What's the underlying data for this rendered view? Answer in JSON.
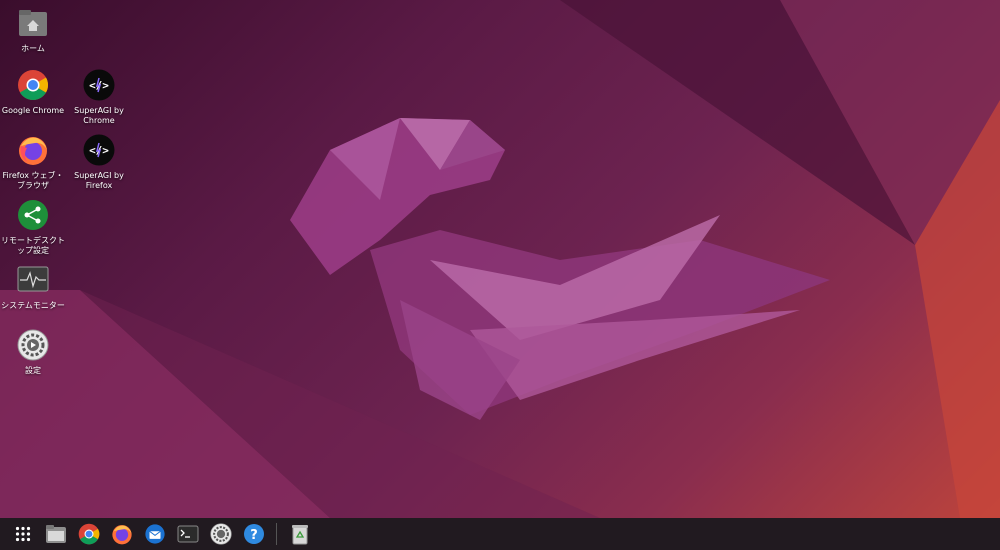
{
  "desktop": {
    "icons": [
      {
        "label": "ホーム",
        "icon": "home-folder-icon"
      },
      {
        "label": "Google Chrome",
        "icon": "chrome-icon"
      },
      {
        "label": "SuperAGI by Chrome",
        "icon": "superagi-icon"
      },
      {
        "label": "Firefox ウェブ・ブラウザ",
        "icon": "firefox-icon"
      },
      {
        "label": "SuperAGI by Firefox",
        "icon": "superagi-icon"
      },
      {
        "label": "リモートデスクトップ設定",
        "icon": "remote-desktop-icon"
      },
      {
        "label": "システムモニター",
        "icon": "system-monitor-icon"
      },
      {
        "label": "設定",
        "icon": "settings-icon"
      }
    ]
  },
  "dock": {
    "items": [
      "apps-grid-icon",
      "files-icon",
      "chrome-icon",
      "firefox-icon",
      "thunderbird-icon",
      "terminal-icon",
      "settings-icon",
      "help-icon",
      "trash-icon"
    ]
  },
  "colors": {
    "dock_bg": "#211a20",
    "accent": "#e95420"
  }
}
